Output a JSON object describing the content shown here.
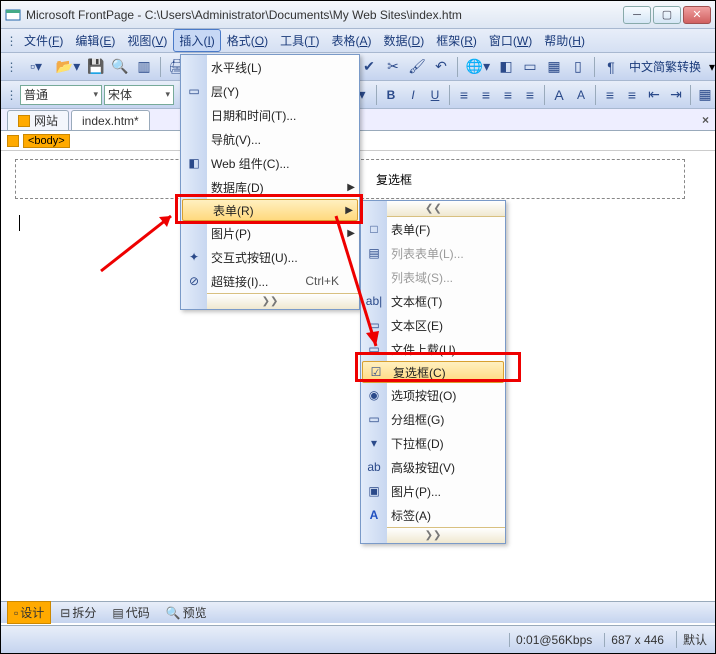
{
  "title": "Microsoft FrontPage - C:\\Users\\Administrator\\Documents\\My Web Sites\\index.htm",
  "menubar": {
    "items": [
      {
        "label": "文件",
        "key": "F"
      },
      {
        "label": "编辑",
        "key": "E"
      },
      {
        "label": "视图",
        "key": "V"
      },
      {
        "label": "插入",
        "key": "I"
      },
      {
        "label": "格式",
        "key": "O"
      },
      {
        "label": "工具",
        "key": "T"
      },
      {
        "label": "表格",
        "key": "A"
      },
      {
        "label": "数据",
        "key": "D"
      },
      {
        "label": "框架",
        "key": "R"
      },
      {
        "label": "窗口",
        "key": "W"
      },
      {
        "label": "帮助",
        "key": "H"
      }
    ]
  },
  "toolbar": {
    "cnswitch": "中文简繁转换"
  },
  "format": {
    "style": "普通",
    "font": "宋体"
  },
  "tabs": {
    "site": "网站",
    "file": "index.htm*"
  },
  "tagbar": {
    "tag": "<body>"
  },
  "canvas": {
    "heading": "复选框"
  },
  "insert_menu": {
    "items": [
      {
        "label": "水平线(L)",
        "ico": ""
      },
      {
        "label": "层(Y)",
        "ico": "▭"
      },
      {
        "label": "日期和时间(T)...",
        "ico": ""
      },
      {
        "label": "导航(V)...",
        "ico": ""
      },
      {
        "label": "Web 组件(C)...",
        "ico": "◧"
      },
      {
        "label": "数据库(D)",
        "ico": "",
        "sub": true
      },
      {
        "label": "表单(R)",
        "ico": "",
        "sub": true,
        "hl": true
      },
      {
        "label": "图片(P)",
        "ico": "",
        "sub": true
      },
      {
        "label": "交互式按钮(U)...",
        "ico": "✦"
      },
      {
        "label": "超链接(I)...",
        "ico": "⊘",
        "hk": "Ctrl+K"
      }
    ]
  },
  "form_menu": {
    "items": [
      {
        "label": "表单(F)",
        "ico": "□"
      },
      {
        "label": "列表表单(L)...",
        "ico": "▤",
        "dis": true
      },
      {
        "label": "列表域(S)...",
        "ico": "",
        "dis": true
      },
      {
        "label": "文本框(T)",
        "ico": "ab|"
      },
      {
        "label": "文本区(E)",
        "ico": "▭"
      },
      {
        "label": "文件上载(U)",
        "ico": "▭"
      },
      {
        "label": "复选框(C)",
        "ico": "☑",
        "hl": true
      },
      {
        "label": "选项按钮(O)",
        "ico": "◉"
      },
      {
        "label": "分组框(G)",
        "ico": "▭"
      },
      {
        "label": "下拉框(D)",
        "ico": "▾"
      },
      {
        "label": "高级按钮(V)",
        "ico": "ab"
      },
      {
        "label": "图片(P)...",
        "ico": "▣"
      },
      {
        "label": "标签(A)",
        "ico": "A"
      }
    ]
  },
  "views": {
    "design": "设计",
    "split": "拆分",
    "code": "代码",
    "preview": "预览"
  },
  "status": {
    "speed": "0:01@56Kbps",
    "size": "687 x 446",
    "mode": "默认"
  }
}
